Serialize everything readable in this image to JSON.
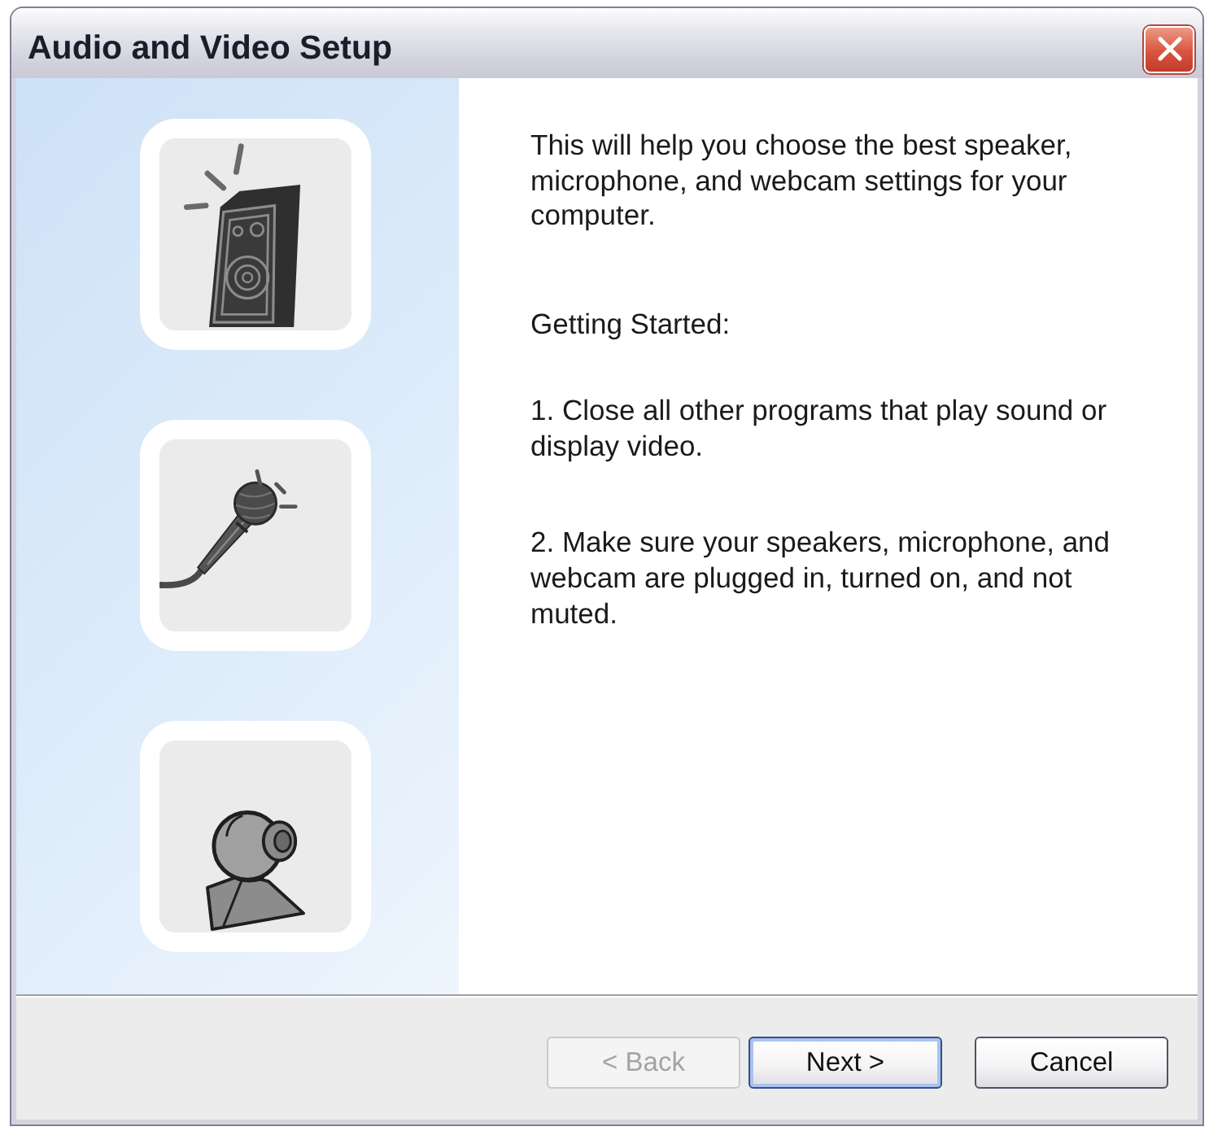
{
  "window": {
    "title": "Audio and Video Setup"
  },
  "sidebar": {
    "tiles": [
      {
        "kind": "speaker"
      },
      {
        "kind": "microphone"
      },
      {
        "kind": "webcam"
      }
    ]
  },
  "content": {
    "paragraphs": [
      "This will help you choose the best speaker, microphone, and webcam settings for your computer.",
      "Getting Started:",
      "1. Close all other programs that play sound or display video.",
      "2. Make sure your speakers, microphone, and webcam are plugged in, turned on, and not muted."
    ]
  },
  "buttons": [
    {
      "label": "< Back",
      "disabled": true,
      "default": false
    },
    {
      "label": "Next >",
      "disabled": false,
      "default": true
    },
    {
      "label": "Cancel",
      "disabled": false,
      "default": false
    }
  ]
}
